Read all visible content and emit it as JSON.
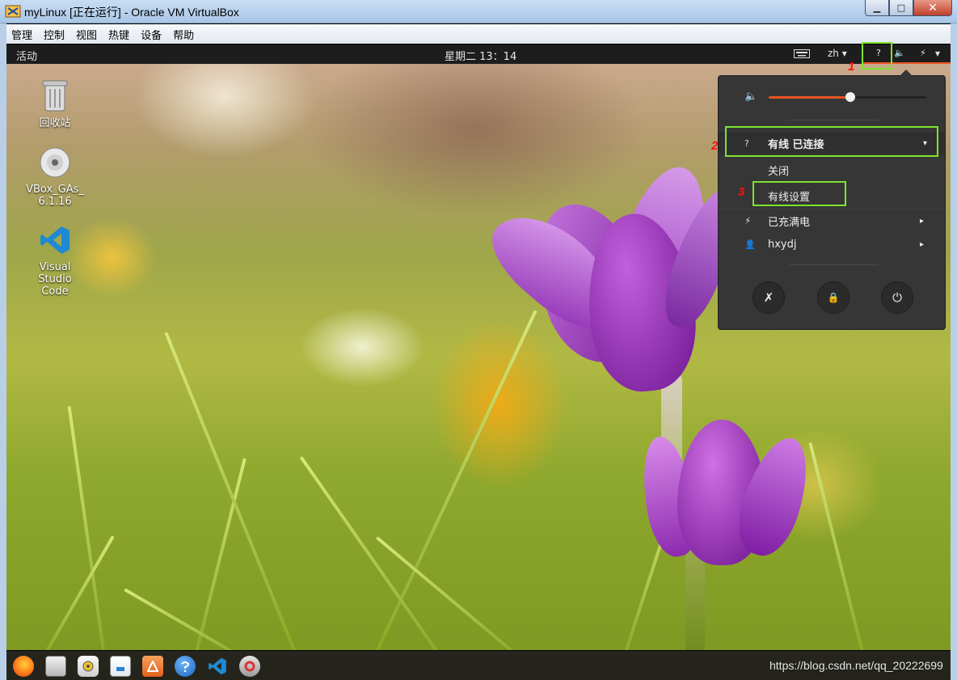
{
  "window": {
    "title": "myLinux [正在运行] - Oracle VM VirtualBox",
    "minimize": "▁",
    "maximize": "□",
    "close": "✕"
  },
  "menubar": {
    "items": [
      "管理",
      "控制",
      "视图",
      "热键",
      "设备",
      "帮助"
    ]
  },
  "topbar": {
    "activities": "活动",
    "clock": "星期二 13：14",
    "keyboard_icon": "keyboard-icon",
    "language": "zh ▾",
    "network_glyph": "?",
    "volume_glyph": "🔈",
    "battery_glyph": "⚡",
    "menu_arrow": "▾"
  },
  "desktop": {
    "icons": [
      {
        "label": "回收站",
        "icon": "trash-icon"
      },
      {
        "label": "VBox_GAs_ 6.1.16",
        "icon": "cdrom-icon"
      },
      {
        "label": "Visual Studio Code",
        "icon": "vscode-icon"
      }
    ]
  },
  "system_menu": {
    "volume_icon": "🔈",
    "volume_level": 0.52,
    "wired_icon": "?",
    "wired_label": "有线 已连接",
    "wired_arrow": "▾",
    "off_label": "关闭",
    "wired_settings_label": "有线设置",
    "battery_icon": "⚡",
    "battery_label": "已充满电",
    "user_icon": "👤",
    "user_label": "hxydj",
    "submenu_arrow": "▸",
    "settings_glyph": "✗",
    "lock_glyph": "🔒",
    "power_glyph": "⏻"
  },
  "annotations": {
    "one": "1",
    "two": "2",
    "three": "3",
    "highlight_color": "#7fe32f",
    "number_color": "#ff1010"
  },
  "dock": {
    "icons": [
      "firefox-icon",
      "files-icon",
      "rhythmbox-icon",
      "libreoffice-writer-icon",
      "software-center-icon",
      "help-icon",
      "vscode-icon",
      "settings-icon"
    ]
  },
  "watermark": "https://blog.csdn.net/qq_20222699",
  "colors": {
    "accent": "#e95420",
    "panel": "#1d1d1d",
    "menu_bg": "#363636"
  }
}
